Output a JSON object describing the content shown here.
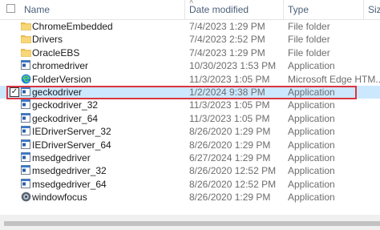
{
  "columns": {
    "name": "Name",
    "date": "Date modified",
    "type": "Type",
    "size": "Siz"
  },
  "files": [
    {
      "name": "ChromeEmbedded",
      "date": "7/4/2023 1:29 PM",
      "type": "File folder",
      "icon": "folder-icon"
    },
    {
      "name": "Drivers",
      "date": "7/4/2023 2:52 PM",
      "type": "File folder",
      "icon": "folder-icon"
    },
    {
      "name": "OracleEBS",
      "date": "7/4/2023 1:29 PM",
      "type": "File folder",
      "icon": "folder-icon"
    },
    {
      "name": "chromedriver",
      "date": "10/30/2023 1:53 PM",
      "type": "Application",
      "icon": "application-icon"
    },
    {
      "name": "FolderVersion",
      "date": "11/3/2023 1:05 PM",
      "type": "Microsoft Edge HTM...",
      "icon": "edge-html-icon"
    },
    {
      "name": "geckodriver",
      "date": "1/2/2024 9:38 PM",
      "type": "Application",
      "icon": "application-icon",
      "selected": true
    },
    {
      "name": "geckodriver_32",
      "date": "11/3/2023 1:05 PM",
      "type": "Application",
      "icon": "application-icon"
    },
    {
      "name": "geckodriver_64",
      "date": "11/3/2023 1:05 PM",
      "type": "Application",
      "icon": "application-icon"
    },
    {
      "name": "IEDriverServer_32",
      "date": "8/26/2020 1:29 PM",
      "type": "Application",
      "icon": "application-icon"
    },
    {
      "name": "IEDriverServer_64",
      "date": "8/26/2020 1:29 PM",
      "type": "Application",
      "icon": "application-icon"
    },
    {
      "name": "msedgedriver",
      "date": "6/27/2024 1:29 PM",
      "type": "Application",
      "icon": "application-icon"
    },
    {
      "name": "msedgedriver_32",
      "date": "8/26/2020 12:52 PM",
      "type": "Application",
      "icon": "application-icon"
    },
    {
      "name": "msedgedriver_64",
      "date": "8/26/2020 12:52 PM",
      "type": "Application",
      "icon": "application-icon"
    },
    {
      "name": "windowfocus",
      "date": "8/26/2020 1:29 PM",
      "type": "Application",
      "icon": "windowfocus-icon"
    }
  ],
  "colors": {
    "selection": "#cce8ff",
    "highlight_border": "#d9363e",
    "folder": "#f3c34a",
    "header_text": "#4c607a"
  }
}
